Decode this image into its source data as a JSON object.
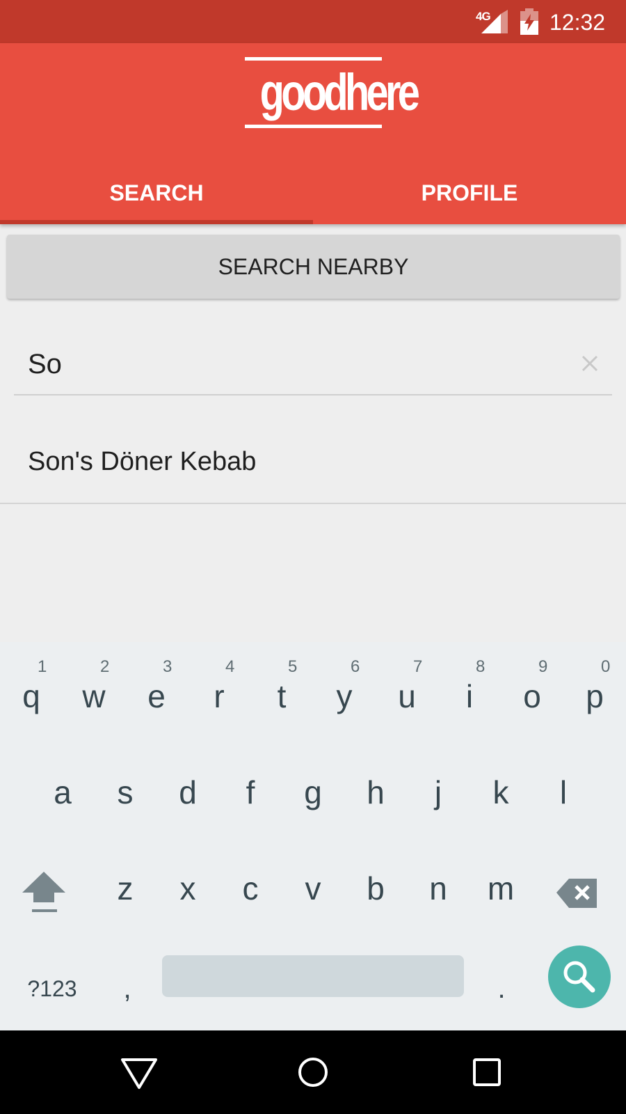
{
  "status_bar": {
    "network_label": "4G",
    "time": "12:32",
    "icons": [
      "signal-icon",
      "battery-charging-icon"
    ]
  },
  "app": {
    "logo_text": "goodhere",
    "colors": {
      "header": "#e84e40",
      "status_bar": "#c0392b",
      "accent": "#4db6ac"
    }
  },
  "tabs": [
    {
      "label": "SEARCH",
      "selected": true
    },
    {
      "label": "PROFILE",
      "selected": false
    }
  ],
  "search_nearby": {
    "label": "SEARCH NEARBY"
  },
  "search": {
    "value": "So",
    "placeholder": "",
    "clear_icon": "close-icon"
  },
  "suggestions": [
    {
      "label": "Son's Döner Kebab"
    }
  ],
  "keyboard": {
    "row1": [
      {
        "char": "q",
        "hint": "1"
      },
      {
        "char": "w",
        "hint": "2"
      },
      {
        "char": "e",
        "hint": "3"
      },
      {
        "char": "r",
        "hint": "4"
      },
      {
        "char": "t",
        "hint": "5"
      },
      {
        "char": "y",
        "hint": "6"
      },
      {
        "char": "u",
        "hint": "7"
      },
      {
        "char": "i",
        "hint": "8"
      },
      {
        "char": "o",
        "hint": "9"
      },
      {
        "char": "p",
        "hint": "0"
      }
    ],
    "row2": [
      "a",
      "s",
      "d",
      "f",
      "g",
      "h",
      "j",
      "k",
      "l"
    ],
    "row3": [
      "z",
      "x",
      "c",
      "v",
      "b",
      "n",
      "m"
    ],
    "symbols_label": "?123",
    "comma": ",",
    "period": ".",
    "action_icon": "search-icon"
  },
  "nav_bar": {
    "icons": [
      "back-icon",
      "home-icon",
      "recents-icon"
    ]
  }
}
